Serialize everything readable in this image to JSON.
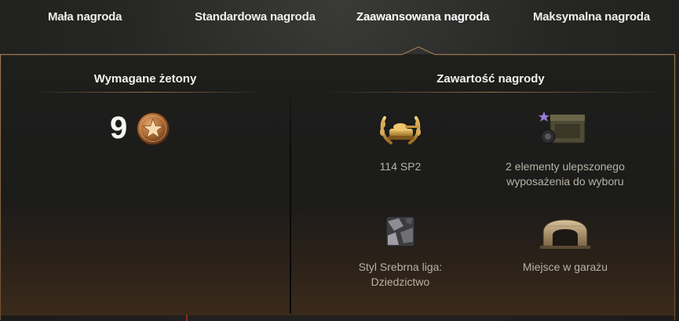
{
  "tabs": [
    {
      "label": "Mała nagroda",
      "active": false
    },
    {
      "label": "Standardowa nagroda",
      "active": false
    },
    {
      "label": "Zaawansowana nagroda",
      "active": true
    },
    {
      "label": "Maksymalna nagroda",
      "active": false
    }
  ],
  "required": {
    "title": "Wymagane żetony",
    "count": "9",
    "icon": "star-token-icon"
  },
  "rewards": {
    "title": "Zawartość nagrody",
    "items": [
      {
        "label": "114 SP2",
        "icon": "tank-laurel-icon"
      },
      {
        "label": "2 elementy ulepszonego\nwyposażenia do wyboru",
        "icon": "equipment-crate-icon"
      },
      {
        "label": "Styl Srebrna liga:\nDziedzictwo",
        "icon": "style-camo-icon"
      },
      {
        "label": "Miejsce w garażu",
        "icon": "garage-slot-icon"
      }
    ]
  },
  "colors": {
    "accent_border": "#8a6a46",
    "gold": "#c99a4a",
    "label_text": "#b7b3a6"
  }
}
